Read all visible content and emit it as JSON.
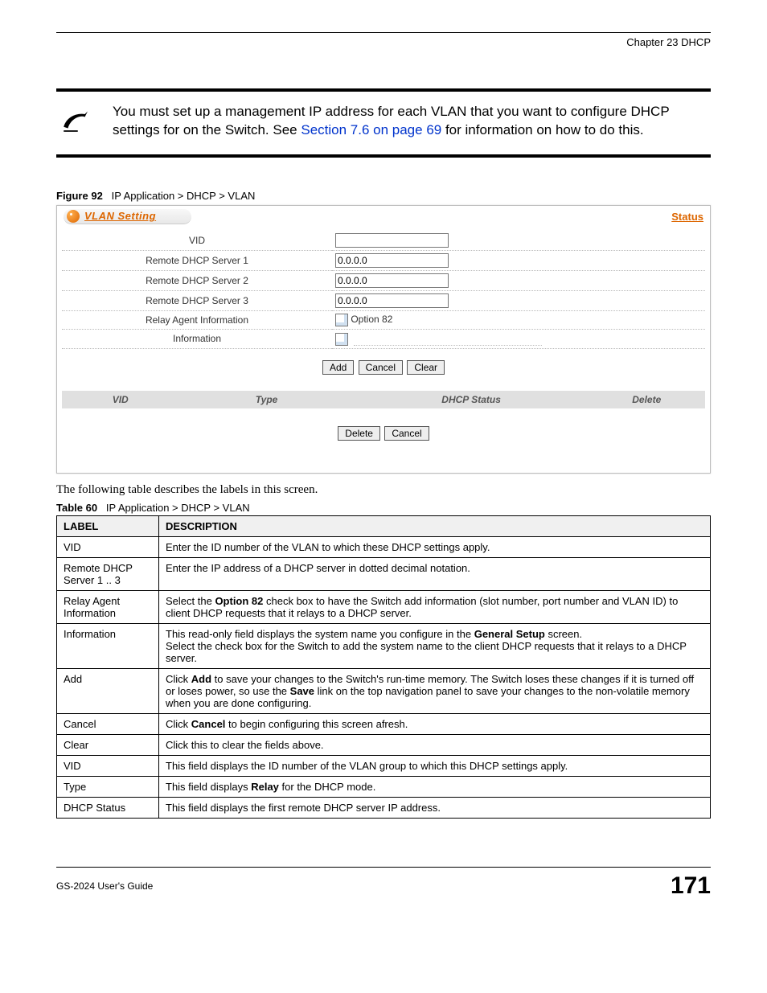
{
  "chapter": "Chapter 23 DHCP",
  "note": {
    "text_before_link": "You must set up a management IP address for each VLAN that you want to configure DHCP settings for on the Switch. See ",
    "link": "Section 7.6 on page 69",
    "text_after_link": " for information on how to do this."
  },
  "figure": {
    "number": "Figure 92",
    "title": "IP Application > DHCP > VLAN"
  },
  "panel": {
    "title": "VLAN Setting",
    "status_link": "Status",
    "fields": {
      "vid_label": "VID",
      "vid_value": "",
      "rds1_label": "Remote DHCP Server 1",
      "rds1_value": "0.0.0.0",
      "rds2_label": "Remote DHCP Server 2",
      "rds2_value": "0.0.0.0",
      "rds3_label": "Remote DHCP Server 3",
      "rds3_value": "0.0.0.0",
      "relay_label": "Relay Agent Information",
      "relay_option": "Option 82",
      "info_label": "Information",
      "info_value": ""
    },
    "buttons1": {
      "add": "Add",
      "cancel": "Cancel",
      "clear": "Clear"
    },
    "list_headers": {
      "vid": "VID",
      "type": "Type",
      "dhcp_status": "DHCP Status",
      "delete": "Delete"
    },
    "buttons2": {
      "delete": "Delete",
      "cancel": "Cancel"
    }
  },
  "intro": "The following table describes the labels in this screen.",
  "table_caption": {
    "number": "Table 60",
    "title": "IP Application > DHCP > VLAN"
  },
  "table": {
    "h1": "LABEL",
    "h2": "DESCRIPTION",
    "rows": [
      {
        "label": "VID",
        "desc": "Enter the ID number of the VLAN to which these DHCP settings apply."
      },
      {
        "label": "Remote DHCP Server 1 .. 3",
        "desc": "Enter the IP address of a DHCP server in dotted decimal notation."
      },
      {
        "label": "Relay Agent Information",
        "desc_pre": "Select the ",
        "desc_bold": "Option 82",
        "desc_post": " check box to have the Switch add information (slot number, port number and VLAN ID) to client DHCP requests that it relays to a DHCP server."
      },
      {
        "label": "Information",
        "desc_pre": "This read-only field displays the system name you configure in the ",
        "desc_bold": "General Setup",
        "desc_post": " screen.",
        "desc_line2": "Select the check box for the Switch to add the system name to the client DHCP requests that it relays to a DHCP server."
      },
      {
        "label": "Add",
        "desc_pre": "Click ",
        "desc_bold": "Add",
        "desc_mid": " to save your changes to the Switch's run-time memory. The Switch loses these changes if it is turned off or loses power, so use the ",
        "desc_bold2": "Save",
        "desc_post": " link on the top navigation panel to save your changes to the non-volatile memory when you are done configuring."
      },
      {
        "label": "Cancel",
        "desc_pre": "Click ",
        "desc_bold": "Cancel",
        "desc_post": " to begin configuring this screen afresh."
      },
      {
        "label": "Clear",
        "desc": "Click this to clear the fields above."
      },
      {
        "label": "VID",
        "desc": "This field displays the ID number of the VLAN group to which this DHCP settings apply."
      },
      {
        "label": "Type",
        "desc_pre": "This field displays ",
        "desc_bold": "Relay",
        "desc_post": " for the DHCP mode."
      },
      {
        "label": "DHCP Status",
        "desc": "This field displays the first remote DHCP server IP address."
      }
    ]
  },
  "footer": {
    "guide": "GS-2024 User's Guide",
    "page": "171"
  }
}
